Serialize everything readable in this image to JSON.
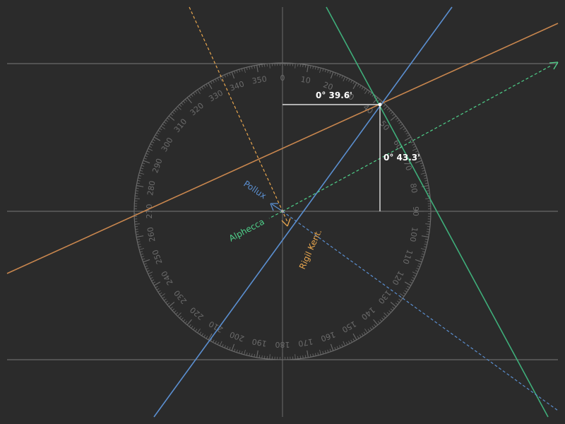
{
  "colors": {
    "background": "#2b2b2b",
    "guide": "#7a7a7a",
    "protractor": "#6b6b6b",
    "orange_line": "#c8864e",
    "blue_line": "#5b8fd0",
    "green_line": "#3fae7a",
    "orange_dashed": "#e8a64e",
    "green_dashed": "#4fd08a",
    "blue_dashed": "#5b8fd0",
    "readout": "#ffffff"
  },
  "protractor": {
    "degree_labels": [
      "0",
      "10",
      "20",
      "30",
      "40",
      "50",
      "60",
      "70",
      "80",
      "90",
      "100",
      "110",
      "120",
      "130",
      "140",
      "150",
      "160",
      "170",
      "180",
      "190",
      "200",
      "210",
      "220",
      "230",
      "240",
      "250",
      "260",
      "270",
      "280",
      "290",
      "300",
      "310",
      "320",
      "330",
      "340",
      "350"
    ]
  },
  "stars": [
    {
      "name": "Pollux",
      "color": "#5b8fd0"
    },
    {
      "name": "Alphecca",
      "color": "#4fd08a"
    },
    {
      "name": "Rigil Kent.",
      "color": "#e8a64e"
    }
  ],
  "readouts": {
    "horizontal": "0° 39.6'",
    "vertical": "0° 43.3'"
  },
  "icons": {
    "arrow": "arrowhead-icon",
    "fix_point": "dot-icon"
  }
}
